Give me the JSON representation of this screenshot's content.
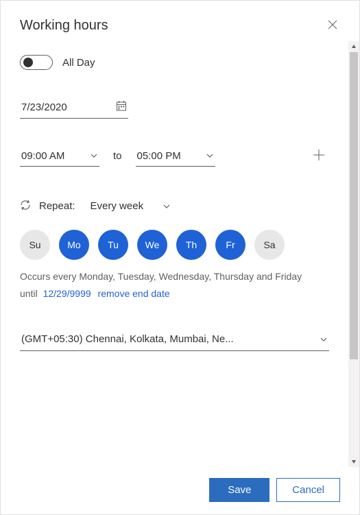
{
  "header": {
    "title": "Working hours"
  },
  "allday": {
    "label": "All Day",
    "enabled": false
  },
  "date": {
    "value": "7/23/2020"
  },
  "time": {
    "start": "09:00 AM",
    "to_label": "to",
    "end": "05:00 PM"
  },
  "repeat": {
    "label": "Repeat:",
    "value": "Every week"
  },
  "days": [
    {
      "abbr": "Su",
      "selected": false
    },
    {
      "abbr": "Mo",
      "selected": true
    },
    {
      "abbr": "Tu",
      "selected": true
    },
    {
      "abbr": "We",
      "selected": true
    },
    {
      "abbr": "Th",
      "selected": true
    },
    {
      "abbr": "Fr",
      "selected": true
    },
    {
      "abbr": "Sa",
      "selected": false
    }
  ],
  "occurrence": {
    "text": "Occurs every Monday, Tuesday, Wednesday, Thursday and Friday",
    "until_label": "until",
    "until_date": "12/29/9999",
    "remove_label": "remove end date"
  },
  "timezone": {
    "value": "(GMT+05:30) Chennai, Kolkata, Mumbai, Ne..."
  },
  "footer": {
    "save": "Save",
    "cancel": "Cancel"
  }
}
